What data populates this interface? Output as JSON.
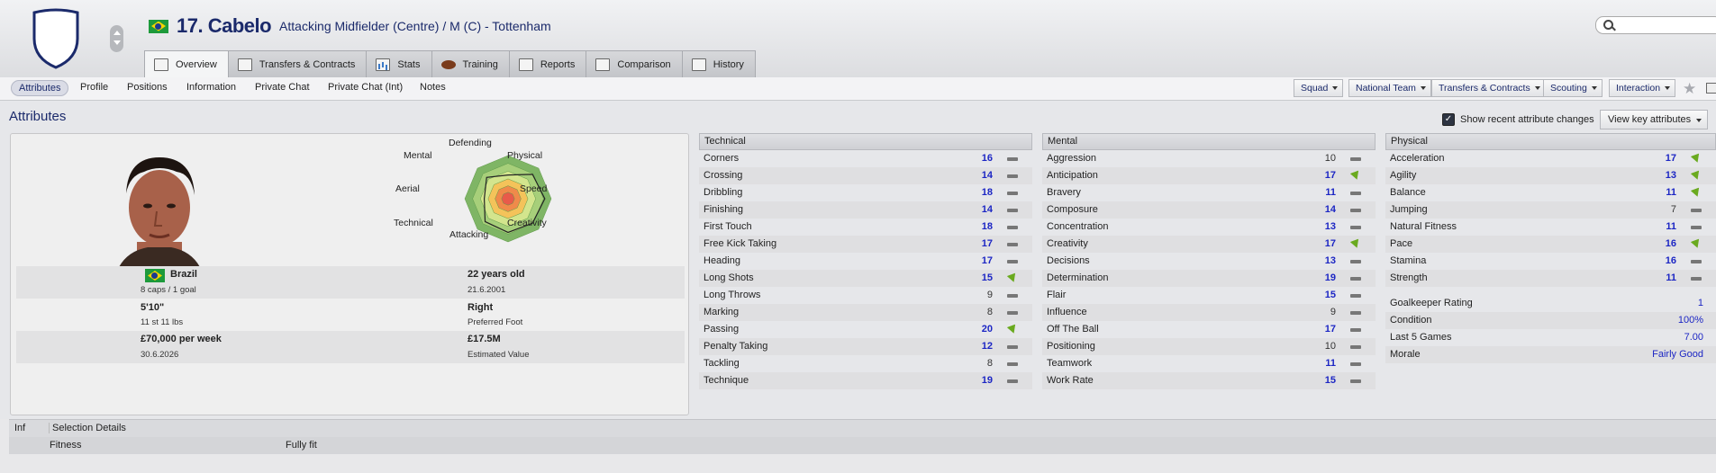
{
  "header": {
    "player_name": "17. Cabelo",
    "player_role": "Attacking Midfielder (Centre) / M (C) - Tottenham",
    "flag": "brazil-flag-icon",
    "crest": "club-crest-icon"
  },
  "tabs": [
    {
      "label": "Overview",
      "icon": "overview-icon",
      "active": true
    },
    {
      "label": "Transfers & Contracts",
      "icon": "document-icon"
    },
    {
      "label": "Stats",
      "icon": "stats-icon"
    },
    {
      "label": "Training",
      "icon": "ball-icon"
    },
    {
      "label": "Reports",
      "icon": "report-icon"
    },
    {
      "label": "Comparison",
      "icon": "comparison-icon"
    },
    {
      "label": "History",
      "icon": "history-icon"
    }
  ],
  "subnav": {
    "links": [
      "Attributes",
      "Profile",
      "Positions",
      "Information",
      "Private Chat",
      "Private Chat (Int)",
      "Notes"
    ],
    "active": "Attributes",
    "dropdowns": [
      "Squad",
      "National Team",
      "Transfers & Contracts",
      "Scouting",
      "Interaction"
    ]
  },
  "section": {
    "title": "Attributes",
    "show_recent_label": "Show recent attribute changes",
    "show_recent_checked": true,
    "key_attributes_label": "View key attributes"
  },
  "radar": {
    "labels": [
      "Defending",
      "Physical",
      "Speed",
      "Creativity",
      "Attacking",
      "Technical",
      "Aerial",
      "Mental"
    ],
    "values": [
      0.55,
      0.8,
      0.85,
      0.8,
      0.78,
      0.75,
      0.55,
      0.7
    ]
  },
  "profile": {
    "nationality": "Brazil",
    "caps": "8 caps / 1 goal",
    "age": "22 years old",
    "dob": "21.6.2001",
    "height": "5'10\"",
    "weight": "11 st 11 lbs",
    "foot": "Right",
    "foot_label": "Preferred Foot",
    "wage": "£70,000 per week",
    "contract_end": "30.6.2026",
    "value": "£17.5M",
    "value_label": "Estimated Value"
  },
  "technical": {
    "title": "Technical",
    "rows": [
      {
        "name": "Corners",
        "value": "16",
        "trend": "flat"
      },
      {
        "name": "Crossing",
        "value": "14",
        "trend": "flat"
      },
      {
        "name": "Dribbling",
        "value": "18",
        "trend": "flat"
      },
      {
        "name": "Finishing",
        "value": "14",
        "trend": "flat"
      },
      {
        "name": "First Touch",
        "value": "18",
        "trend": "flat"
      },
      {
        "name": "Free Kick Taking",
        "value": "17",
        "trend": "flat"
      },
      {
        "name": "Heading",
        "value": "17",
        "trend": "flat"
      },
      {
        "name": "Long Shots",
        "value": "15",
        "trend": "up"
      },
      {
        "name": "Long Throws",
        "value": "9",
        "trend": "flat"
      },
      {
        "name": "Marking",
        "value": "8",
        "trend": "flat"
      },
      {
        "name": "Passing",
        "value": "20",
        "trend": "up"
      },
      {
        "name": "Penalty Taking",
        "value": "12",
        "trend": "flat"
      },
      {
        "name": "Tackling",
        "value": "8",
        "trend": "flat"
      },
      {
        "name": "Technique",
        "value": "19",
        "trend": "flat"
      }
    ]
  },
  "mental": {
    "title": "Mental",
    "rows": [
      {
        "name": "Aggression",
        "value": "10",
        "trend": "flat"
      },
      {
        "name": "Anticipation",
        "value": "17",
        "trend": "up"
      },
      {
        "name": "Bravery",
        "value": "11",
        "trend": "flat"
      },
      {
        "name": "Composure",
        "value": "14",
        "trend": "flat"
      },
      {
        "name": "Concentration",
        "value": "13",
        "trend": "flat"
      },
      {
        "name": "Creativity",
        "value": "17",
        "trend": "up"
      },
      {
        "name": "Decisions",
        "value": "13",
        "trend": "flat"
      },
      {
        "name": "Determination",
        "value": "19",
        "trend": "flat"
      },
      {
        "name": "Flair",
        "value": "15",
        "trend": "flat"
      },
      {
        "name": "Influence",
        "value": "9",
        "trend": "flat"
      },
      {
        "name": "Off The Ball",
        "value": "17",
        "trend": "flat"
      },
      {
        "name": "Positioning",
        "value": "10",
        "trend": "flat"
      },
      {
        "name": "Teamwork",
        "value": "11",
        "trend": "flat"
      },
      {
        "name": "Work Rate",
        "value": "15",
        "trend": "flat"
      }
    ]
  },
  "physical": {
    "title": "Physical",
    "rows": [
      {
        "name": "Acceleration",
        "value": "17",
        "trend": "up"
      },
      {
        "name": "Agility",
        "value": "13",
        "trend": "up"
      },
      {
        "name": "Balance",
        "value": "11",
        "trend": "up"
      },
      {
        "name": "Jumping",
        "value": "7",
        "trend": "flat"
      },
      {
        "name": "Natural Fitness",
        "value": "11",
        "trend": "flat"
      },
      {
        "name": "Pace",
        "value": "16",
        "trend": "up"
      },
      {
        "name": "Stamina",
        "value": "16",
        "trend": "flat"
      },
      {
        "name": "Strength",
        "value": "11",
        "trend": "flat"
      }
    ],
    "extra": [
      {
        "name": "Goalkeeper Rating",
        "value": "1"
      },
      {
        "name": "Condition",
        "value": "100%"
      },
      {
        "name": "Last 5 Games",
        "value": "7.00"
      },
      {
        "name": "Morale",
        "value": "Fairly Good"
      }
    ]
  },
  "selection": {
    "col_inf": "Inf",
    "col_details": "Selection Details",
    "row_label": "Fitness",
    "row_value": "Fully fit"
  },
  "colors": {
    "brand_navy": "#1b2a6b",
    "high_value": "#1c26c4",
    "trend_up": "#6aaa1f"
  }
}
